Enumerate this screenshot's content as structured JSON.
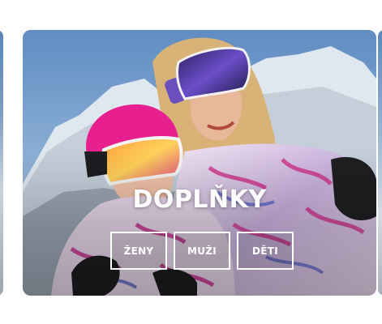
{
  "category_card": {
    "title": "DOPLŇKY",
    "buttons": [
      {
        "label": "ŽENY"
      },
      {
        "label": "MUŽI"
      },
      {
        "label": "DĚTI"
      }
    ]
  },
  "colors": {
    "sky": "#6d95c6",
    "snow": "#e6ecf2",
    "helmet_pink": "#e81f8f",
    "goggle_lens": "#3b2a7a",
    "button_border": "#ffffff"
  }
}
